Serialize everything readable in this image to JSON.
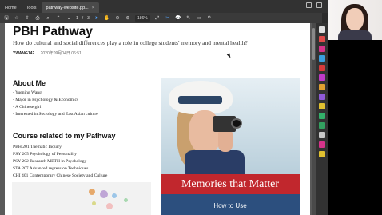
{
  "tabs": {
    "home": "Home",
    "tools": "Tools",
    "document": "pathway-website.pp...",
    "close": "×"
  },
  "toolbar": {
    "page_current": "1",
    "page_sep": "/",
    "page_total": "3",
    "zoom": "186%"
  },
  "document": {
    "title": "PBH Pathway",
    "subtitle": "How do cultural and social differences play a role in college students' memory and mental health?",
    "author": "YWANG142",
    "date": "2020年09月04日 06:51",
    "about_heading": "About Me",
    "about_items": [
      "- Yuening Wang",
      "- Major in Psychology & Economics",
      "- A Chinese girl",
      "- Interested in Sociology and East Asian culture"
    ],
    "course_heading": "Course related to my Pathway",
    "course_items": [
      "PBH 201 Thematic Inquiry",
      "PSY 205 Psychology of Personality",
      "PSY 202 Research METH in Psychology",
      "STA 207 Advanced regression Techniques",
      "CHI 401 Contemporary Chinese Society and Culture"
    ],
    "book_title": "Memories that Matter",
    "book_subtitle": "How to Use"
  },
  "colors": {
    "accent_blue": "#56a6ff",
    "book_red": "#c1272d",
    "book_blue": "#2c4f7e"
  }
}
